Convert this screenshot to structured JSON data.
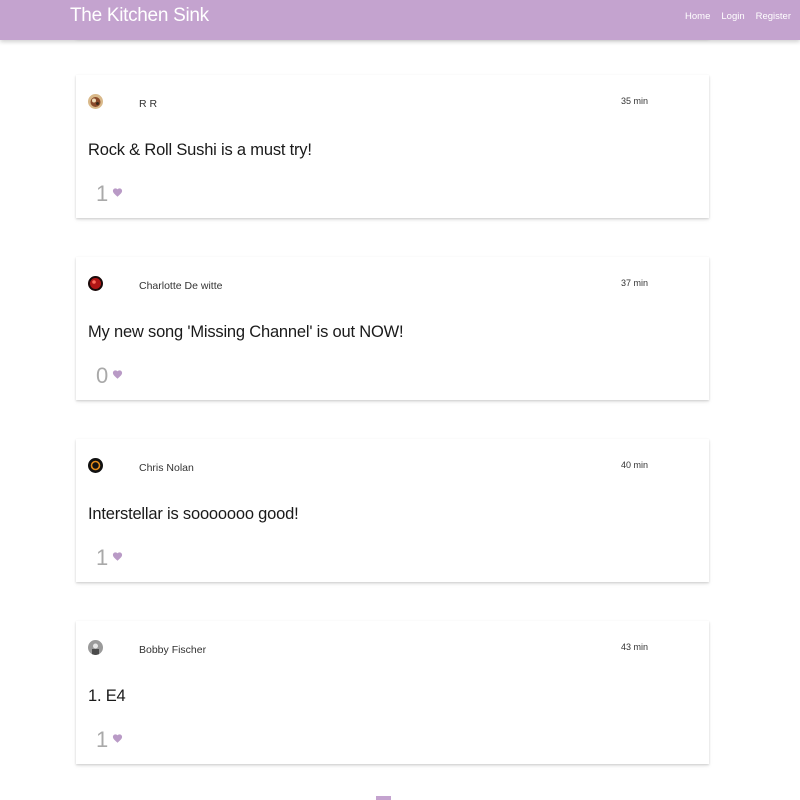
{
  "navbar": {
    "brand": "The Kitchen Sink",
    "links": [
      "Home",
      "Login",
      "Register"
    ]
  },
  "accent_color": "#c4a3cf",
  "posts": [
    {
      "author": "R R",
      "time": "35 min",
      "text": "Rock & Roll Sushi is a must try!",
      "likes": "1",
      "avatar": "photo-avatar-food"
    },
    {
      "author": "Charlotte De witte",
      "time": "37 min",
      "text": "My new song 'Missing Channel' is out NOW!",
      "likes": "0",
      "avatar": "photo-avatar-red"
    },
    {
      "author": "Chris Nolan",
      "time": "40 min",
      "text": "Interstellar is sooooooo good!",
      "likes": "1",
      "avatar": "photo-avatar-ring"
    },
    {
      "author": "Bobby Fischer",
      "time": "43 min",
      "text": "1. E4",
      "likes": "1",
      "avatar": "photo-avatar-gray"
    }
  ]
}
